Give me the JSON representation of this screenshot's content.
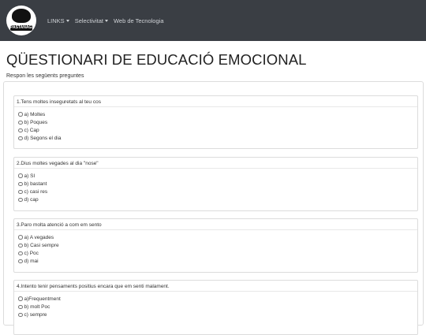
{
  "navbar": {
    "logo_text": "PASTANAGA",
    "links": [
      {
        "label": "LINKS",
        "dropdown": true
      },
      {
        "label": "Selectivitat",
        "dropdown": true
      },
      {
        "label": "Web de Tecnologia",
        "dropdown": false
      }
    ]
  },
  "page": {
    "title": "QÜESTIONARI DE EDUCACIÓ EMOCIONAL",
    "subtitle": "Respon les següents preguntes"
  },
  "questions": [
    {
      "title": "1.Tens moltes inseguretats al teu cos",
      "options": [
        "a) Moltes",
        "b) Poques",
        "c) Cap",
        "d) Segons el dia"
      ]
    },
    {
      "title": "2.Dius moltes vegades al dia \"nose\"",
      "options": [
        "a) SI",
        "b) bastant",
        "c) casi res",
        "d) cap"
      ]
    },
    {
      "title": "3.Paro molta atenció a com em sento",
      "options": [
        "a) A vegades",
        "b) Casi sempre",
        "c) Poc",
        "d) mai"
      ]
    },
    {
      "title": "4.Intento tenir pensaments positius encara que em senti malament.",
      "options": [
        "a)Frequentment",
        "b) molt Poc",
        "c) sempre"
      ]
    }
  ],
  "colors": {
    "navbar_bg": "#3a3e44",
    "nav_link": "#cfd2d6",
    "border": "#dcdcdc"
  }
}
